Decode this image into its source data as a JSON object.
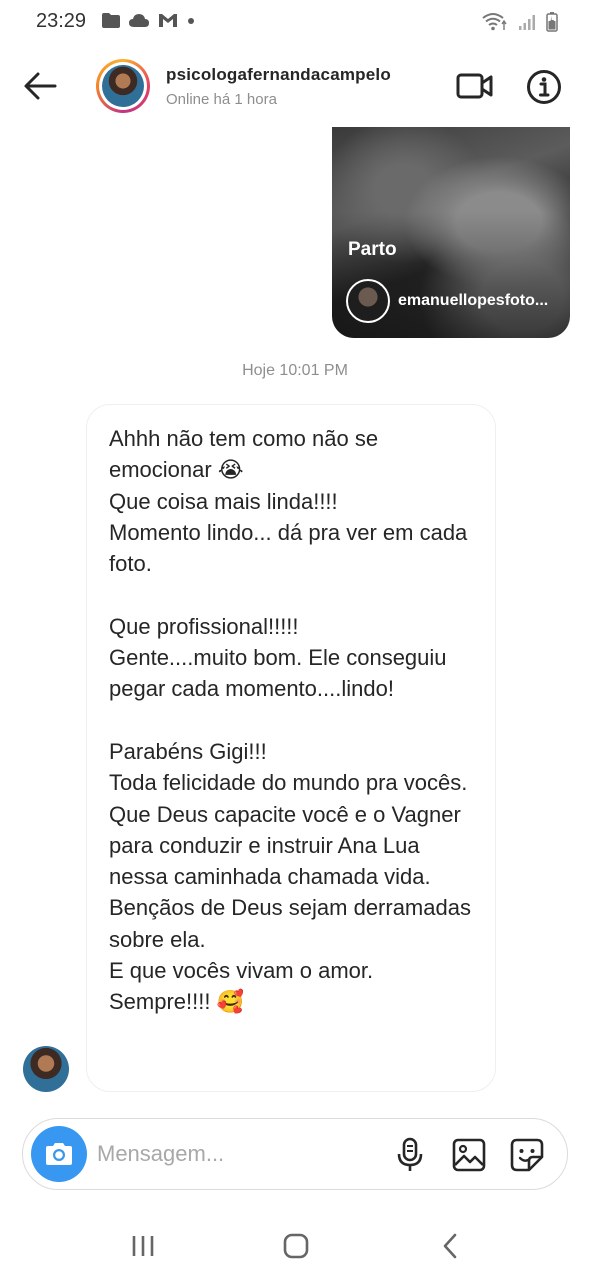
{
  "status_bar": {
    "time": "23:29",
    "left_icons": [
      "folder-icon",
      "cloud-icon",
      "gmail-icon",
      "dot-icon"
    ],
    "right_icons": [
      "wifi-icon",
      "signal-icon",
      "battery-icon"
    ]
  },
  "header": {
    "username": "psicologafernandacampelo",
    "status": "Online há 1 hora"
  },
  "shared_post": {
    "caption": "Parto",
    "author": "emanuellopesfoto..."
  },
  "timestamp": "Hoje 10:01 PM",
  "message": {
    "text": "Ahhh não tem como não se emocionar 😭\nQue coisa mais linda!!!!\nMomento lindo... dá pra ver em cada foto.\n\nQue profissional!!!!!\nGente....muito bom. Ele conseguiu pegar cada momento....lindo!\n\nParabéns Gigi!!!\nToda felicidade do mundo pra vocês. Que Deus capacite você e o Vagner para conduzir e instruir Ana Lua nessa caminhada chamada vida.\nBençãos de Deus sejam derramadas sobre ela.\nE que vocês vivam o amor. Sempre!!!! 🥰"
  },
  "composer": {
    "placeholder": "Mensagem..."
  },
  "colors": {
    "accent": "#3897f0",
    "text": "#262626",
    "secondary": "#8e8e8e"
  }
}
